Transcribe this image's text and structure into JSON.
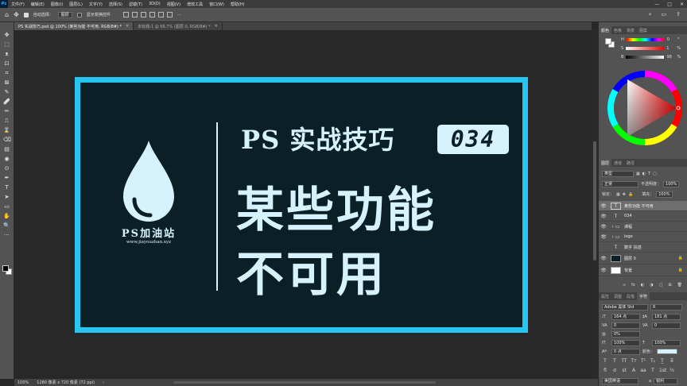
{
  "app": {
    "logo": "Ps"
  },
  "menu": [
    "文件(F)",
    "编辑(E)",
    "图像(I)",
    "图层(L)",
    "文字(Y)",
    "选择(S)",
    "滤镜(T)",
    "3D(D)",
    "视图(V)",
    "增效工具",
    "窗口(W)",
    "帮助(H)"
  ],
  "window_controls": {
    "minimize": "—",
    "maximize": "□",
    "close": "✕"
  },
  "options": {
    "auto_select_label": "自动选择：",
    "auto_select_value": "图层",
    "show_transform_label": "显示变换控件",
    "more": "···",
    "right_icons": [
      "⌕",
      "▭",
      "⇪"
    ]
  },
  "tabs": [
    {
      "label": "PS 实战技巧.psd @ 100% (某些功能 不可用, RGB/8#) *",
      "active": true
    },
    {
      "label": "未标题-1 @ 66.7% (图层 0, RGB/8#) *",
      "active": false
    }
  ],
  "tools": [
    "✥",
    "⬚",
    "ᴥ",
    "⊡",
    "⌗",
    "⊠",
    "✎",
    "🩹",
    "✏",
    "⎍",
    "⌛",
    "⌫",
    "▤",
    "◉",
    "⊙",
    "✒",
    "T",
    "➤",
    "▭",
    "✋",
    "🔍",
    "···"
  ],
  "artwork": {
    "brand": "PS加油站",
    "url": "www.jiayouzhan.xyz",
    "title": "PS 实战技巧",
    "badge": "034",
    "line1": "某些功能",
    "line2": "不可用",
    "colors": {
      "frame": "#27c5f2",
      "background": "#0b1f26",
      "text": "#d6f3fd"
    }
  },
  "status": {
    "zoom": "100%",
    "doc_size": "1280 像素 x 720 像素 (72 ppi)",
    "arrow": "›"
  },
  "color_panel": {
    "tabs": [
      "颜色",
      "色板",
      "渐变",
      "图案"
    ],
    "sliders": [
      {
        "label": "H",
        "value": "0",
        "unit": "°"
      },
      {
        "label": "S",
        "value": "1",
        "unit": "%"
      },
      {
        "label": "B",
        "value": "98",
        "unit": "%"
      }
    ]
  },
  "layers_panel": {
    "tabs": [
      "图层",
      "通道",
      "路径"
    ],
    "filter_label": "类型",
    "blend_mode": "正常",
    "opacity_label": "不透明度：",
    "opacity_value": "100%",
    "lock_label": "锁定：",
    "fill_label": "填充：",
    "fill_value": "100%",
    "layers": [
      {
        "name": "某些功能 不可用",
        "type": "text",
        "selected": true
      },
      {
        "name": "034",
        "type": "text",
        "selected": false
      },
      {
        "name": "课程",
        "type": "folder",
        "selected": false
      },
      {
        "name": "logo",
        "type": "folder",
        "selected": false
      },
      {
        "name": "数字 扶迹",
        "type": "text",
        "selected": false
      },
      {
        "name": "图层 0",
        "type": "image",
        "selected": false
      },
      {
        "name": "背景",
        "type": "image",
        "selected": false
      }
    ],
    "footer_icons": [
      "∞",
      "fx",
      "◐",
      "◑",
      "▢",
      "⊞",
      "🗑"
    ]
  },
  "character_panel": {
    "tabs": [
      "属性",
      "调整",
      "段落",
      "字符"
    ],
    "font_family": "Adobe 黑体 Std",
    "font_style": "R",
    "font_size": "164 点",
    "leading": "181 点",
    "kerning": "0",
    "tracking": "0",
    "baseline_shift": "0%",
    "vertical_scale": "100%",
    "horizontal_scale": "100%",
    "baseline": "0 点",
    "color_label": "颜色：",
    "language": "美国英语",
    "aa_label": "a",
    "aa_value": "锐利",
    "format_buttons": [
      "T",
      "T",
      "TT",
      "Tт",
      "T¹",
      "T₁",
      "T̲",
      "T̶"
    ]
  }
}
